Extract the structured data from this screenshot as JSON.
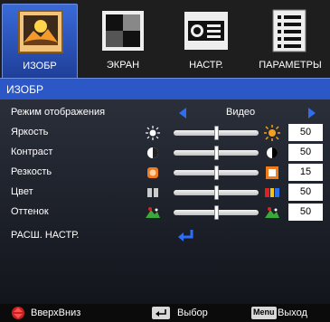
{
  "tabs": [
    {
      "label": "ИЗОБР",
      "icon": "picture-icon",
      "active": true
    },
    {
      "label": "ЭКРАН",
      "icon": "screen-icon",
      "active": false
    },
    {
      "label": "НАСТР.",
      "icon": "projector-icon",
      "active": false
    },
    {
      "label": "ПАРАМЕТРЫ",
      "icon": "options-icon",
      "active": false
    }
  ],
  "header": {
    "title": "ИЗОБР"
  },
  "rows": [
    {
      "label": "Режим отображения",
      "value": "Видео"
    },
    {
      "label": "Яркость",
      "value": "50",
      "level": 0.5
    },
    {
      "label": "Контраст",
      "value": "50",
      "level": 0.5
    },
    {
      "label": "Резкость",
      "value": "15",
      "level": 0.5
    },
    {
      "label": "Цвет",
      "value": "50",
      "level": 0.5
    },
    {
      "label": "Оттенок",
      "value": "50",
      "level": 0.5
    },
    {
      "label": "РАСШ. НАСТР."
    }
  ],
  "footer": {
    "nav": "ВверхВниз",
    "select": "Выбор",
    "menu_key": "Menu",
    "exit": "Выход"
  },
  "colors": {
    "accent": "#2c57c6",
    "arrow": "#2e6ef5",
    "highlight": "#f07a1e"
  }
}
